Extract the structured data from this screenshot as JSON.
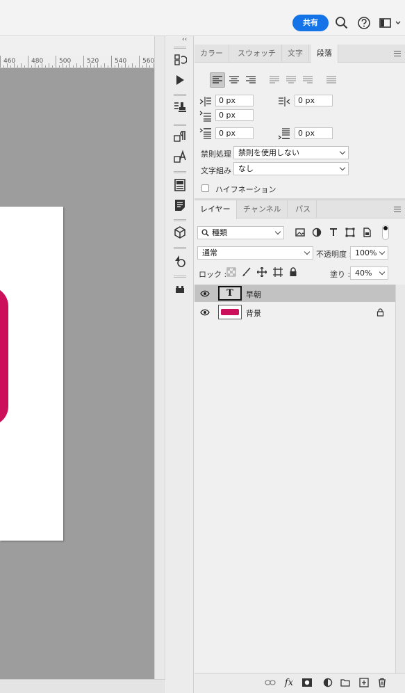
{
  "topbar": {
    "share_label": "共有",
    "icons": [
      "search-icon",
      "help-icon",
      "workspace-icon"
    ]
  },
  "ruler": {
    "labels": [
      "460",
      "480",
      "500",
      "520",
      "540",
      "560"
    ]
  },
  "panels": {
    "top_tabs": [
      {
        "label": "カラー"
      },
      {
        "label": "スウォッチ"
      },
      {
        "label": "文字"
      },
      {
        "label": "段落"
      }
    ],
    "paragraph": {
      "left_indent": "0 px",
      "right_indent": "0 px",
      "first_line_indent": "0 px",
      "space_before": "0 px",
      "space_after": "0 px",
      "kinsoku_label": "禁則処理",
      "kinsoku_value": "禁則を使用しない",
      "mojikumi_label": "文字組み",
      "mojikumi_value": "なし",
      "hyphenation_label": "ハイフネーション",
      "hyphenation_checked": false
    },
    "layer_tabs": [
      {
        "label": "レイヤー"
      },
      {
        "label": "チャンネル"
      },
      {
        "label": "パス"
      }
    ],
    "layers": {
      "filter_kind": "種類",
      "blend_mode": "通常",
      "opacity_label": "不透明度 :",
      "opacity_value": "100%",
      "lock_label": "ロック :",
      "fill_label": "塗り :",
      "fill_value": "40%",
      "items": [
        {
          "name": "早朝",
          "type": "text",
          "thumb_glyph": "T",
          "selected": true,
          "locked": false
        },
        {
          "name": "背景",
          "type": "image",
          "selected": false,
          "locked": true
        }
      ]
    }
  },
  "colors": {
    "accent": "#1473e6",
    "artwork_pink": "#cc0f5b",
    "canvas_gray": "#9d9d9d"
  }
}
